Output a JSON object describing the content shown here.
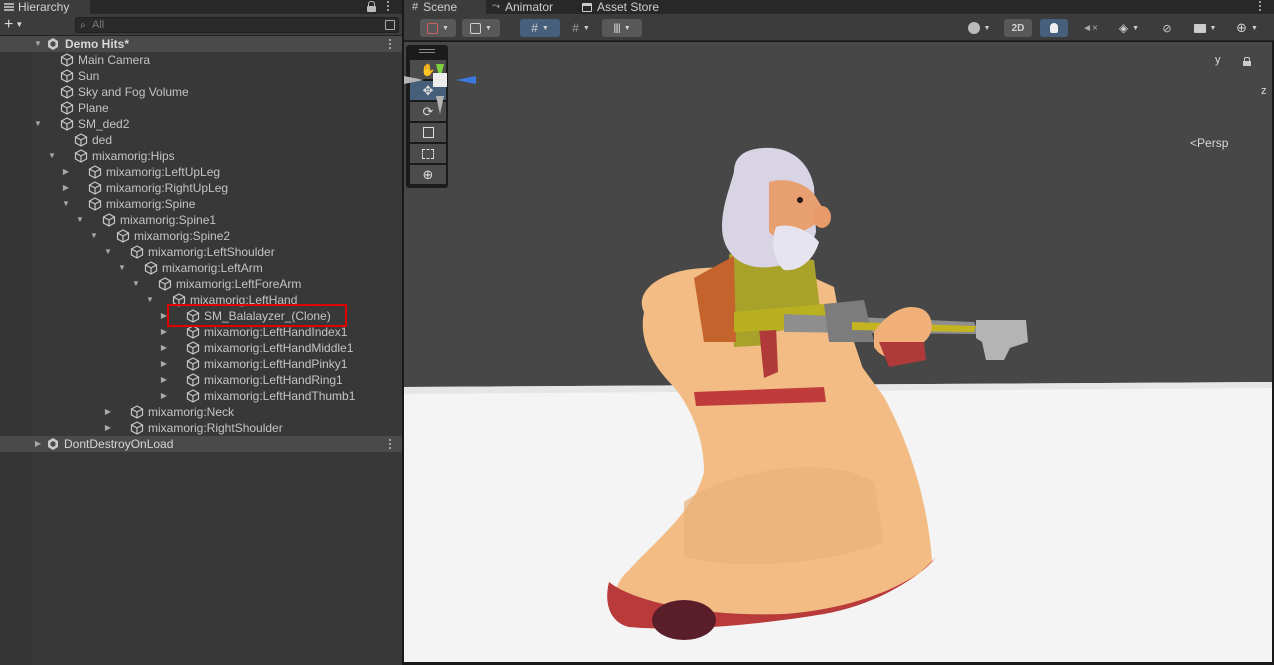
{
  "hierarchy": {
    "tab_label": "Hierarchy",
    "add_button_label": "+",
    "search_placeholder": "All",
    "scene_name": "Demo Hits*",
    "items": [
      {
        "label": "Main Camera"
      },
      {
        "label": "Sun"
      },
      {
        "label": "Sky and Fog Volume"
      },
      {
        "label": "Plane"
      },
      {
        "label": "SM_ded2"
      },
      {
        "label": "ded"
      },
      {
        "label": "mixamorig:Hips"
      },
      {
        "label": "mixamorig:LeftUpLeg"
      },
      {
        "label": "mixamorig:RightUpLeg"
      },
      {
        "label": "mixamorig:Spine"
      },
      {
        "label": "mixamorig:Spine1"
      },
      {
        "label": "mixamorig:Spine2"
      },
      {
        "label": "mixamorig:LeftShoulder"
      },
      {
        "label": "mixamorig:LeftArm"
      },
      {
        "label": "mixamorig:LeftForeArm"
      },
      {
        "label": "mixamorig:LeftHand"
      },
      {
        "label": "SM_Balalayzer_(Clone)"
      },
      {
        "label": "mixamorig:LeftHandIndex1"
      },
      {
        "label": "mixamorig:LeftHandMiddle1"
      },
      {
        "label": "mixamorig:LeftHandPinky1"
      },
      {
        "label": "mixamorig:LeftHandRing1"
      },
      {
        "label": "mixamorig:LeftHandThumb1"
      },
      {
        "label": "mixamorig:Neck"
      },
      {
        "label": "mixamorig:RightShoulder"
      }
    ],
    "second_scene": "DontDestroyOnLoad"
  },
  "scene_view": {
    "tabs": [
      {
        "label": "Scene",
        "icon": "hash-icon"
      },
      {
        "label": "Animator",
        "icon": "animator-icon"
      },
      {
        "label": "Asset Store",
        "icon": "store-icon"
      }
    ],
    "toolbar": {
      "mode_2d_label": "2D"
    },
    "gizmo": {
      "y_label": "y",
      "z_label": "z",
      "projection_label": "Persp"
    }
  },
  "colors": {
    "panel_bg": "#383838",
    "scene_row_bg": "#4a4a4a",
    "highlight_border": "#e00000",
    "active_tool": "#46607c",
    "gizmo_y": "#7cd13a",
    "gizmo_z": "#3a7ae0"
  }
}
